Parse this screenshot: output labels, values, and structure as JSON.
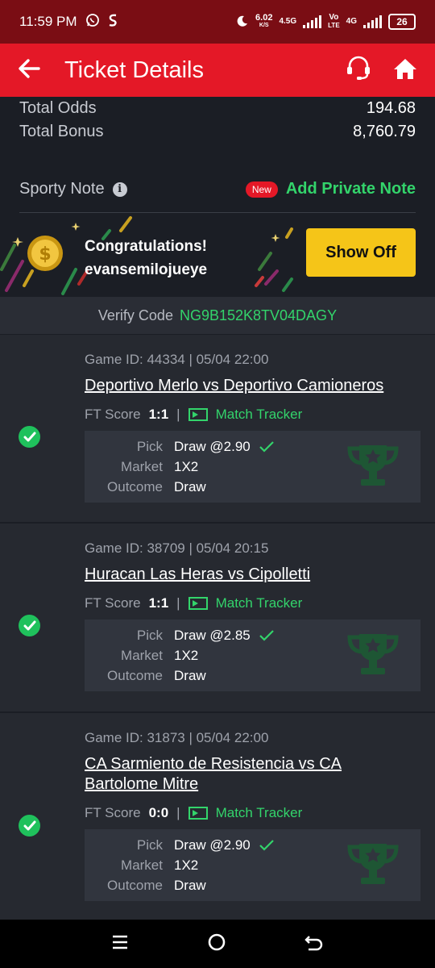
{
  "status": {
    "time": "11:59 PM",
    "speed_value": "6.02",
    "speed_unit": "K/S",
    "net1": "4.5G",
    "volte_top": "Vo",
    "volte_bottom": "LTE",
    "net2": "4G",
    "battery": "26"
  },
  "header": {
    "title": "Ticket Details"
  },
  "summary": {
    "total_odds_label": "Total Odds",
    "total_odds": "194.68",
    "total_bonus_label": "Total Bonus",
    "total_bonus": "8,760.79"
  },
  "note": {
    "label": "Sporty Note",
    "info": "i",
    "new_badge": "New",
    "add_label": "Add Private Note"
  },
  "congrats": {
    "line1": "Congratulations!",
    "line2": "evansemilojueye",
    "button": "Show Off"
  },
  "verify": {
    "label": "Verify Code",
    "code": "NG9B152K8TV04DAGY"
  },
  "games": [
    {
      "game_id": "Game ID: 44334 | 05/04 22:00",
      "match": "Deportivo Merlo vs Deportivo Camioneros",
      "ft_label": "FT Score",
      "score": "1:1",
      "sep": "|",
      "tracker": "Match Tracker",
      "pick_label": "Pick",
      "pick": "Draw @2.90",
      "market_label": "Market",
      "market": "1X2",
      "outcome_label": "Outcome",
      "outcome": "Draw"
    },
    {
      "game_id": "Game ID: 38709 | 05/04 20:15",
      "match": "Huracan Las Heras vs Cipolletti",
      "ft_label": "FT Score",
      "score": "1:1",
      "sep": "|",
      "tracker": "Match Tracker",
      "pick_label": "Pick",
      "pick": "Draw @2.85",
      "market_label": "Market",
      "market": "1X2",
      "outcome_label": "Outcome",
      "outcome": "Draw"
    },
    {
      "game_id": "Game ID: 31873 | 05/04 22:00",
      "match_line1": "CA Sarmiento de Resistencia vs CA",
      "match_line2": "Bartolome Mitre",
      "ft_label": "FT Score",
      "score": "0:0",
      "sep": "|",
      "tracker": "Match Tracker",
      "pick_label": "Pick",
      "pick": "Draw @2.90",
      "market_label": "Market",
      "market": "1X2",
      "outcome_label": "Outcome",
      "outcome": "Draw"
    }
  ],
  "colors": {
    "header_red": "#e41827",
    "status_red": "#7a0d14",
    "accent_green": "#33d46b",
    "button_yellow": "#f5c518"
  }
}
